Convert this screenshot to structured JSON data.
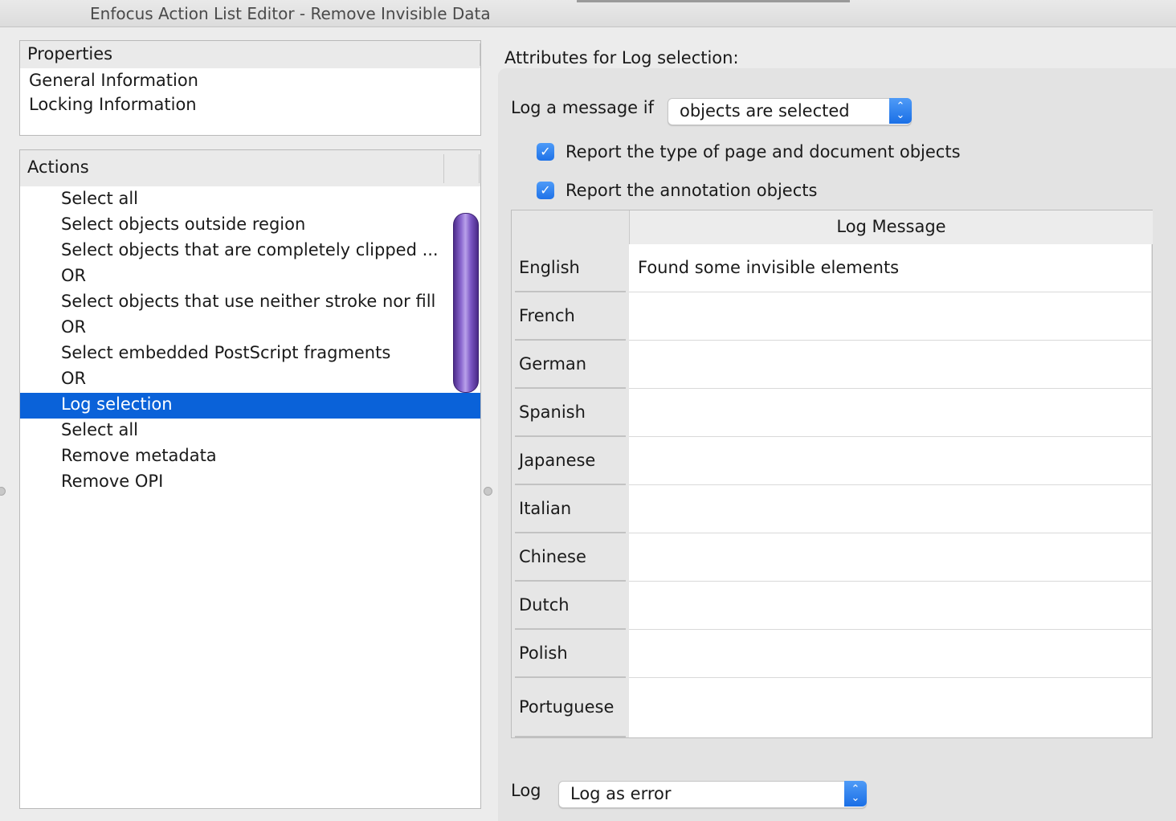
{
  "window": {
    "title": "Enfocus Action List Editor - Remove Invisible Data"
  },
  "properties": {
    "header": "Properties",
    "items": [
      "General Information",
      "Locking Information"
    ]
  },
  "actions": {
    "header": "Actions",
    "items": [
      "Select all",
      "Select objects outside region",
      "Select objects that are completely clipped ...",
      "OR",
      "Select objects that use neither stroke nor fill",
      "OR",
      "Select embedded PostScript fragments",
      "OR",
      "Log selection",
      "Select all",
      "Remove metadata",
      "Remove OPI"
    ],
    "selected_index": 8
  },
  "attributes": {
    "title": "Attributes for Log selection:",
    "log_if_label": "Log a message if",
    "log_if_value": "objects are selected",
    "checkbox_page_objects": {
      "label": "Report the type of page and document objects",
      "checked": true
    },
    "checkbox_annotations": {
      "label": "Report the annotation objects",
      "checked": true
    },
    "table": {
      "header": "Log Message",
      "rows": [
        {
          "lang": "English",
          "msg": "Found some invisible elements"
        },
        {
          "lang": "French",
          "msg": ""
        },
        {
          "lang": "German",
          "msg": ""
        },
        {
          "lang": "Spanish",
          "msg": ""
        },
        {
          "lang": "Japanese",
          "msg": ""
        },
        {
          "lang": "Italian",
          "msg": ""
        },
        {
          "lang": "Chinese",
          "msg": ""
        },
        {
          "lang": "Dutch",
          "msg": ""
        },
        {
          "lang": "Polish",
          "msg": ""
        },
        {
          "lang": "Portuguese",
          "msg": ""
        }
      ]
    },
    "log_label": "Log",
    "log_value": "Log as error"
  },
  "icons": {
    "stepper": "up-down-chevron-icon",
    "check": "checkmark-icon"
  },
  "colors": {
    "selection": "#0a62d9",
    "accent": "#1f72e8",
    "scrollbar": "#7b56c4"
  }
}
